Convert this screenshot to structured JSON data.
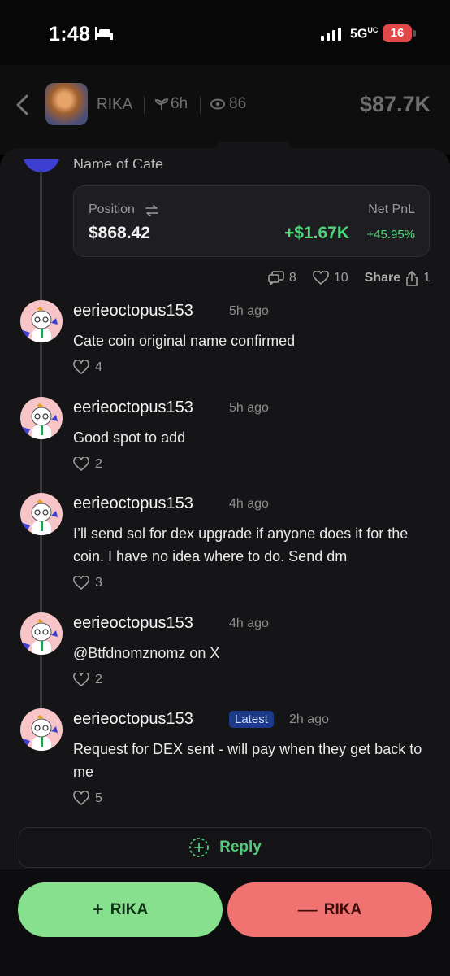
{
  "status_bar": {
    "time": "1:48",
    "network": "5G",
    "network_sup": "UC",
    "battery": "16"
  },
  "header": {
    "token_name": "RIKA",
    "age": "6h",
    "views": "86",
    "price": "$87.7K"
  },
  "post": {
    "peek_text": "Name of Cate",
    "position_label": "Position",
    "position_value": "$868.42",
    "pnl_label": "Net PnL",
    "pnl_value": "+$1.67K",
    "pnl_pct": "+45.95%",
    "comments_count": "8",
    "likes_count": "10",
    "share_label": "Share",
    "share_count": "1"
  },
  "comments": [
    {
      "user": "eerieoctopus153",
      "time": "5h ago",
      "text": "Cate coin original name confirmed",
      "likes": "4",
      "badge": ""
    },
    {
      "user": "eerieoctopus153",
      "time": "5h ago",
      "text": "Good spot to add",
      "likes": "2",
      "badge": ""
    },
    {
      "user": "eerieoctopus153",
      "time": "4h ago",
      "text": "I’ll send sol for dex upgrade if anyone does it for the coin. I have no idea where to do. Send dm",
      "likes": "3",
      "badge": ""
    },
    {
      "user": "eerieoctopus153",
      "time": "4h ago",
      "text": "@Btfdnomznomz on X",
      "likes": "2",
      "badge": ""
    },
    {
      "user": "eerieoctopus153",
      "time": "2h ago",
      "text": "Request for DEX sent - will pay when they get back to me",
      "likes": "5",
      "badge": "Latest"
    }
  ],
  "reply": {
    "label": "Reply"
  },
  "trade": {
    "buy_label": "RIKA",
    "buy_symbol": "+",
    "sell_label": "RIKA",
    "sell_symbol": "—"
  },
  "colors": {
    "buy": "#86e08e",
    "sell": "#f07271",
    "accent_green": "#4fd67a",
    "badge_bg": "#1d3a8a"
  }
}
